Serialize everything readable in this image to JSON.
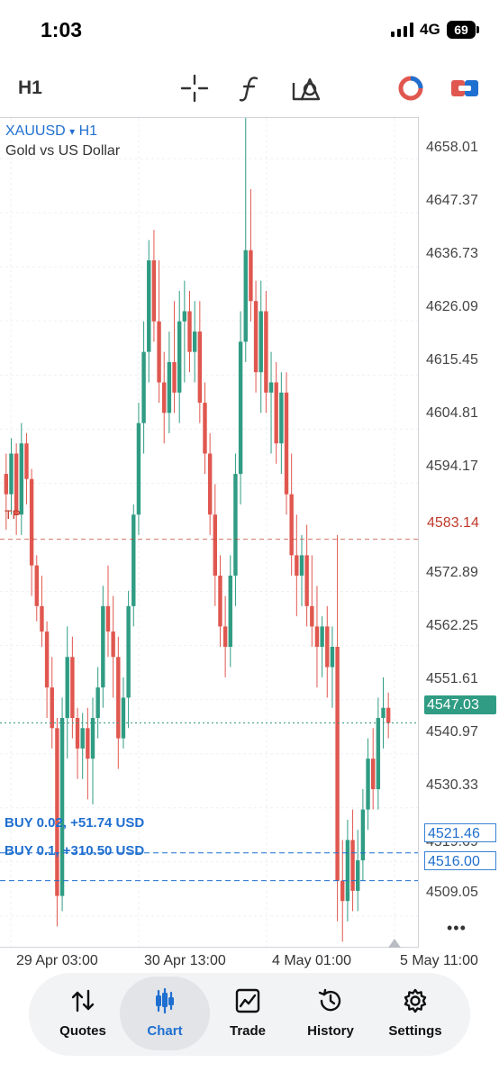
{
  "status": {
    "time": "1:03",
    "network": "4G",
    "battery": "69"
  },
  "toolbar": {
    "timeframe": "H1",
    "icons": [
      "crosshair-icon",
      "function-icon",
      "objects-icon",
      "trade-balance-icon",
      "one-click-trading-icon"
    ]
  },
  "chart_info": {
    "symbol": "XAUUSD",
    "dropdown": "▾",
    "timeframe": "H1",
    "description": "Gold vs US Dollar"
  },
  "price_axis": [
    "4658.01",
    "4647.37",
    "4636.73",
    "4626.09",
    "4615.45",
    "4604.81",
    "4594.17",
    "4572.89",
    "4562.25",
    "4551.61",
    "4540.97",
    "4530.33",
    "4519.69",
    "4509.05"
  ],
  "tp": {
    "label": "TP",
    "price": "4583.14"
  },
  "current_price": "4547.03",
  "positions": [
    {
      "label": "BUY 0.02, +51.74 USD",
      "price": "4521.46"
    },
    {
      "label": "BUY 0.1, +310.50 USD",
      "price": "4516.00"
    }
  ],
  "time_axis": [
    "29 Apr 03:00",
    "30 Apr 13:00",
    "4 May 01:00",
    "5 May 11:00"
  ],
  "more": "•••",
  "nav": [
    {
      "label": "Quotes",
      "icon": "quotes-icon"
    },
    {
      "label": "Chart",
      "icon": "chart-icon"
    },
    {
      "label": "Trade",
      "icon": "trade-icon"
    },
    {
      "label": "History",
      "icon": "history-icon"
    },
    {
      "label": "Settings",
      "icon": "settings-icon"
    }
  ],
  "colors": {
    "bull": "#2f9c83",
    "bear": "#e0574f",
    "accent": "#1f6fd0",
    "tp": "#c0392b"
  },
  "chart_data": {
    "type": "candlestick",
    "symbol": "XAUUSD",
    "timeframe": "H1",
    "ylim": [
      4503,
      4666
    ],
    "candles": [
      [
        4596,
        4600,
        4585,
        4592
      ],
      [
        4592,
        4603,
        4588,
        4600
      ],
      [
        4600,
        4602,
        4584,
        4588
      ],
      [
        4588,
        4606,
        4584,
        4602
      ],
      [
        4602,
        4604,
        4590,
        4595
      ],
      [
        4595,
        4597,
        4572,
        4578
      ],
      [
        4578,
        4580,
        4567,
        4570
      ],
      [
        4570,
        4576,
        4562,
        4565
      ],
      [
        4565,
        4567,
        4548,
        4554
      ],
      [
        4554,
        4560,
        4542,
        4546
      ],
      [
        4546,
        4548,
        4507,
        4513
      ],
      [
        4513,
        4552,
        4510,
        4548
      ],
      [
        4548,
        4566,
        4540,
        4560
      ],
      [
        4560,
        4564,
        4544,
        4548
      ],
      [
        4548,
        4550,
        4536,
        4542
      ],
      [
        4542,
        4549,
        4536,
        4546
      ],
      [
        4546,
        4550,
        4532,
        4540
      ],
      [
        4540,
        4552,
        4531,
        4548
      ],
      [
        4548,
        4558,
        4544,
        4554
      ],
      [
        4554,
        4574,
        4550,
        4570
      ],
      [
        4570,
        4578,
        4560,
        4565
      ],
      [
        4565,
        4572,
        4552,
        4560
      ],
      [
        4560,
        4564,
        4538,
        4544
      ],
      [
        4544,
        4556,
        4542,
        4552
      ],
      [
        4552,
        4573,
        4546,
        4570
      ],
      [
        4570,
        4590,
        4566,
        4588
      ],
      [
        4588,
        4610,
        4584,
        4606
      ],
      [
        4606,
        4626,
        4600,
        4620
      ],
      [
        4620,
        4642,
        4614,
        4638
      ],
      [
        4638,
        4644,
        4622,
        4626
      ],
      [
        4626,
        4638,
        4610,
        4614
      ],
      [
        4614,
        4620,
        4602,
        4608
      ],
      [
        4608,
        4624,
        4604,
        4618
      ],
      [
        4618,
        4630,
        4608,
        4612
      ],
      [
        4612,
        4632,
        4606,
        4626
      ],
      [
        4626,
        4634,
        4614,
        4628
      ],
      [
        4628,
        4632,
        4616,
        4620
      ],
      [
        4620,
        4630,
        4614,
        4624
      ],
      [
        4624,
        4630,
        4606,
        4610
      ],
      [
        4610,
        4614,
        4596,
        4600
      ],
      [
        4600,
        4604,
        4584,
        4588
      ],
      [
        4588,
        4594,
        4570,
        4576
      ],
      [
        4576,
        4580,
        4562,
        4566
      ],
      [
        4566,
        4572,
        4556,
        4562
      ],
      [
        4562,
        4580,
        4558,
        4576
      ],
      [
        4576,
        4600,
        4570,
        4596
      ],
      [
        4596,
        4628,
        4590,
        4622
      ],
      [
        4622,
        4666,
        4618,
        4640
      ],
      [
        4640,
        4652,
        4626,
        4630
      ],
      [
        4630,
        4634,
        4612,
        4616
      ],
      [
        4616,
        4634,
        4608,
        4628
      ],
      [
        4628,
        4632,
        4608,
        4612
      ],
      [
        4612,
        4620,
        4600,
        4614
      ],
      [
        4614,
        4618,
        4598,
        4602
      ],
      [
        4602,
        4616,
        4596,
        4612
      ],
      [
        4612,
        4616,
        4588,
        4592
      ],
      [
        4592,
        4600,
        4576,
        4580
      ],
      [
        4580,
        4588,
        4568,
        4576
      ],
      [
        4576,
        4584,
        4570,
        4580
      ],
      [
        4580,
        4586,
        4566,
        4570
      ],
      [
        4570,
        4580,
        4562,
        4566
      ],
      [
        4566,
        4574,
        4554,
        4562
      ],
      [
        4562,
        4568,
        4556,
        4566
      ],
      [
        4566,
        4570,
        4552,
        4558
      ],
      [
        4558,
        4566,
        4550,
        4562
      ],
      [
        4562,
        4584,
        4508,
        4516
      ],
      [
        4516,
        4524,
        4504,
        4512
      ],
      [
        4512,
        4528,
        4508,
        4524
      ],
      [
        4524,
        4530,
        4510,
        4514
      ],
      [
        4514,
        4526,
        4510,
        4520
      ],
      [
        4520,
        4534,
        4516,
        4530
      ],
      [
        4530,
        4544,
        4526,
        4540
      ],
      [
        4540,
        4546,
        4530,
        4534
      ],
      [
        4534,
        4552,
        4530,
        4548
      ],
      [
        4548,
        4556,
        4542,
        4550
      ],
      [
        4550,
        4553,
        4544,
        4547
      ]
    ]
  }
}
